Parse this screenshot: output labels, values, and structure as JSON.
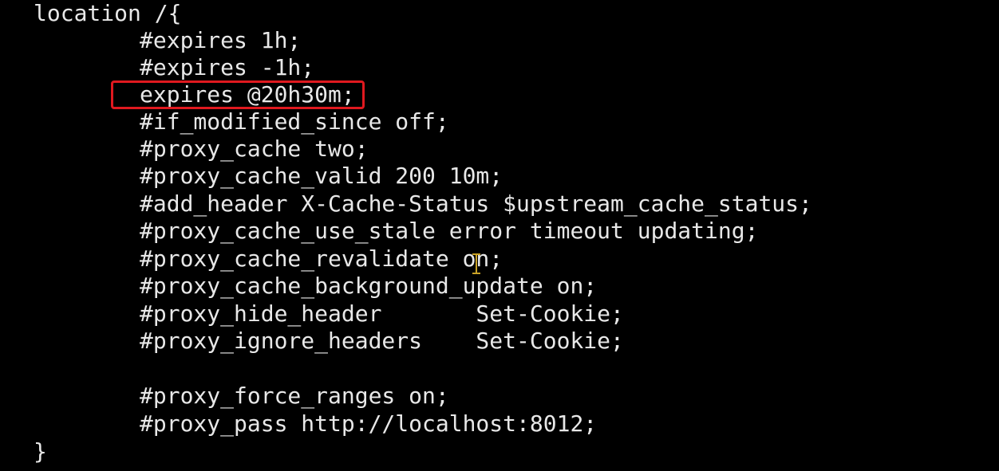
{
  "terminal": {
    "background": "#000000",
    "text_color": "#e8e8e8",
    "highlight_color": "#e0191f",
    "cursor_color": "#c9a227",
    "cursor_icon": "text-cursor-icon",
    "lines": [
      "location /{",
      "#expires 1h;",
      "#expires -1h;",
      "expires @20h30m;",
      "#if_modified_since off;",
      "#proxy_cache two;",
      "#proxy_cache_valid 200 10m;",
      "#add_header X-Cache-Status $upstream_cache_status;",
      "#proxy_cache_use_stale error timeout updating;",
      "#proxy_cache_revalidate on;",
      "#proxy_cache_background_update on;",
      "#proxy_hide_header       Set-Cookie;",
      "#proxy_ignore_headers    Set-Cookie;",
      "",
      "#proxy_force_ranges on;",
      "#proxy_pass http://localhost:8012;",
      "}"
    ]
  }
}
